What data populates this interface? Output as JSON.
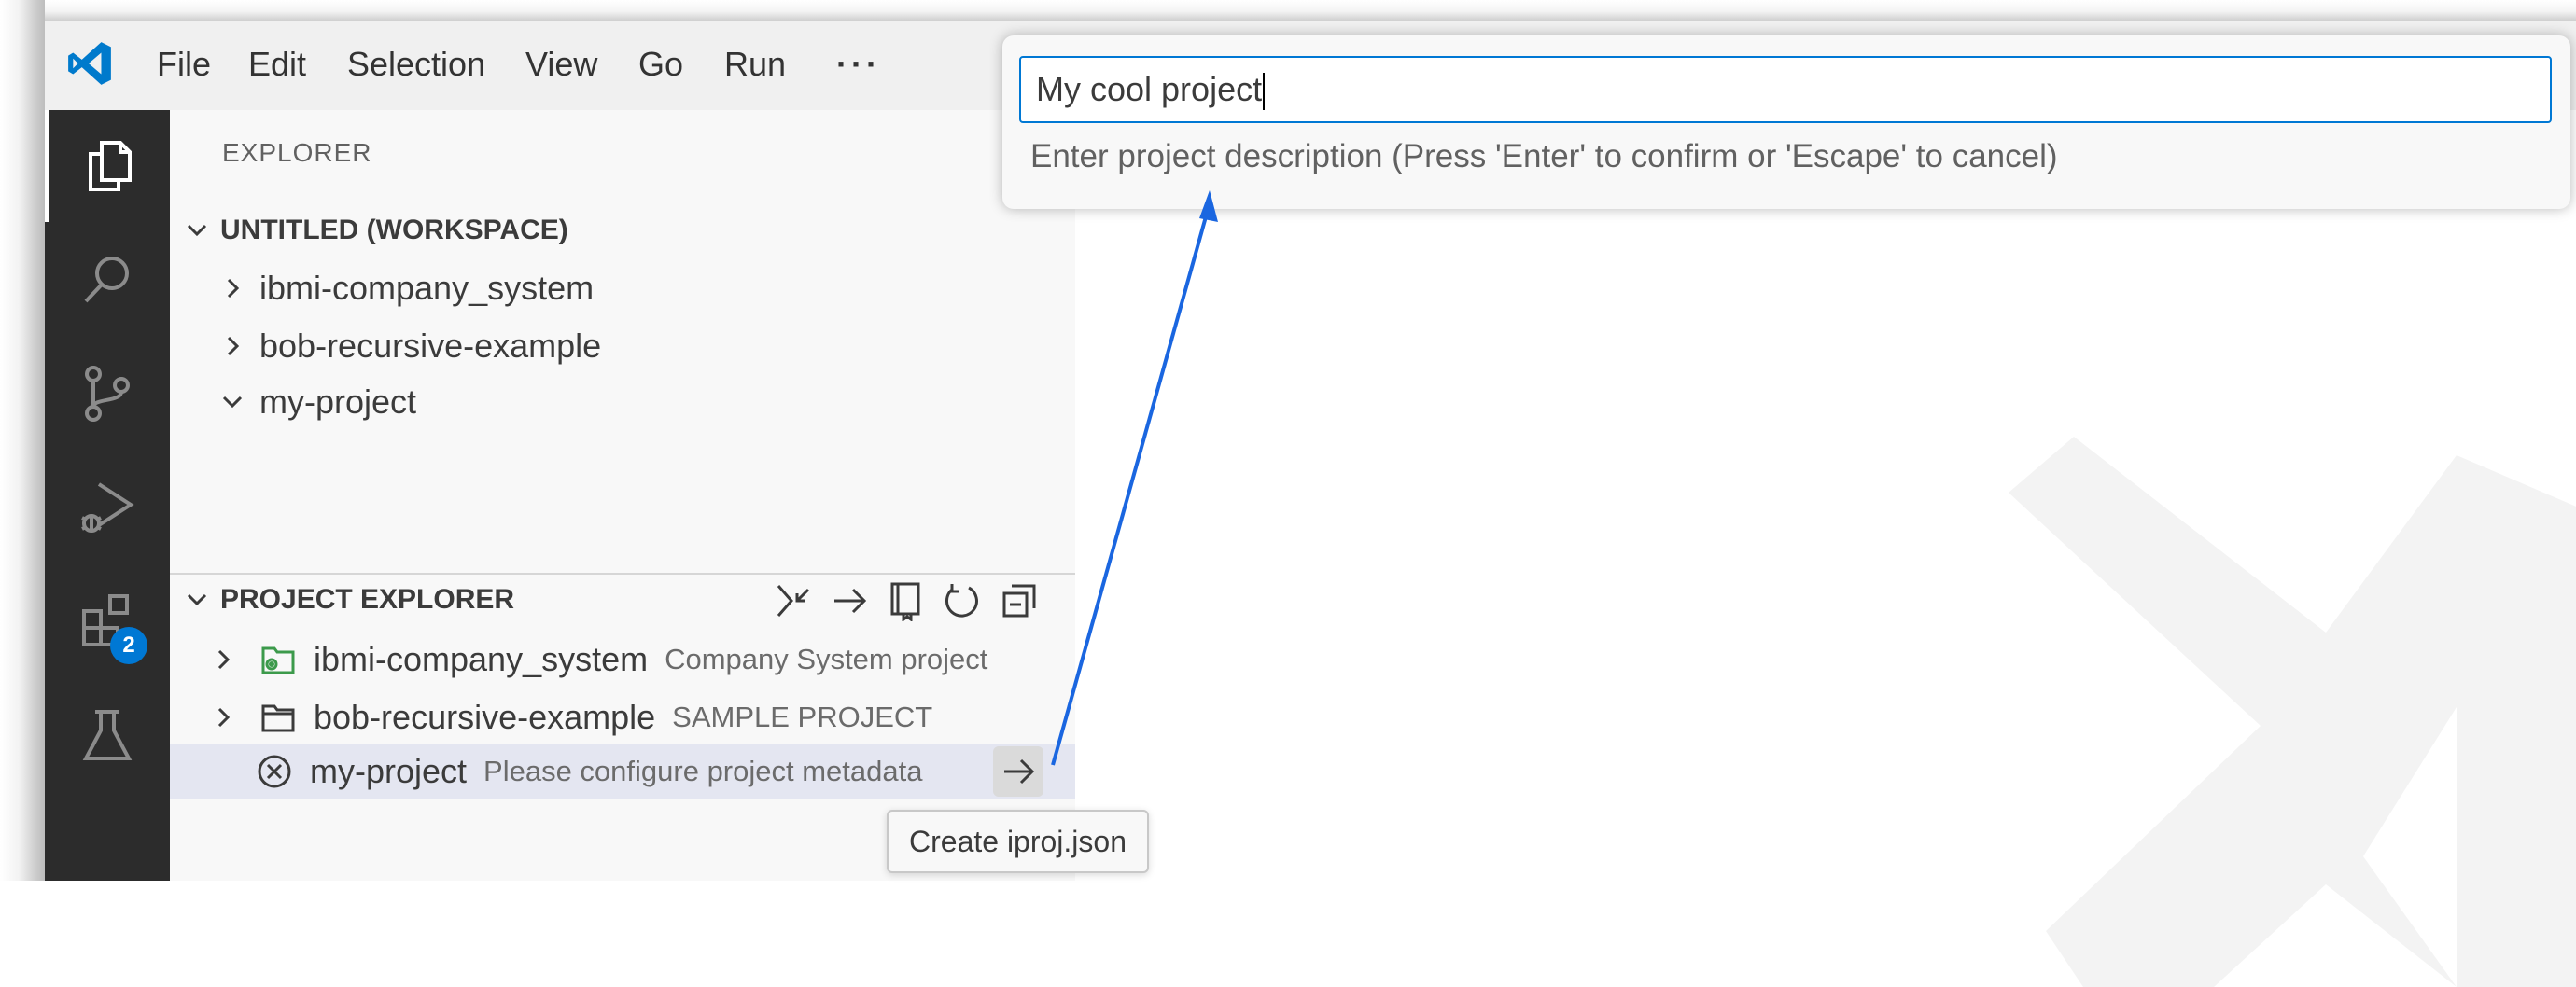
{
  "menu": {
    "items": [
      "File",
      "Edit",
      "Selection",
      "View",
      "Go",
      "Run"
    ],
    "more": "···"
  },
  "activity_bar": {
    "extensions_badge": "2"
  },
  "explorer": {
    "title": "EXPLORER",
    "workspace": {
      "header": "UNTITLED (WORKSPACE)",
      "folders": [
        "ibmi-company_system",
        "bob-recursive-example",
        "my-project"
      ]
    },
    "project_explorer": {
      "header": "PROJECT EXPLORER",
      "projects": [
        {
          "name": "ibmi-company_system",
          "description": "Company System project"
        },
        {
          "name": "bob-recursive-example",
          "description": "SAMPLE PROJECT"
        },
        {
          "name": "my-project",
          "description": "Please configure project metadata"
        }
      ]
    },
    "tooltip": "Create iproj.json"
  },
  "quick_input": {
    "value": "My cool project",
    "message": "Enter project description (Press 'Enter' to confirm or 'Escape' to cancel)"
  },
  "colors": {
    "accent": "#0078d4",
    "annotation_arrow": "#1a66e0",
    "activity_bar": "#2c2c2c",
    "ibmi_project_icon": "#3c9a4b"
  }
}
